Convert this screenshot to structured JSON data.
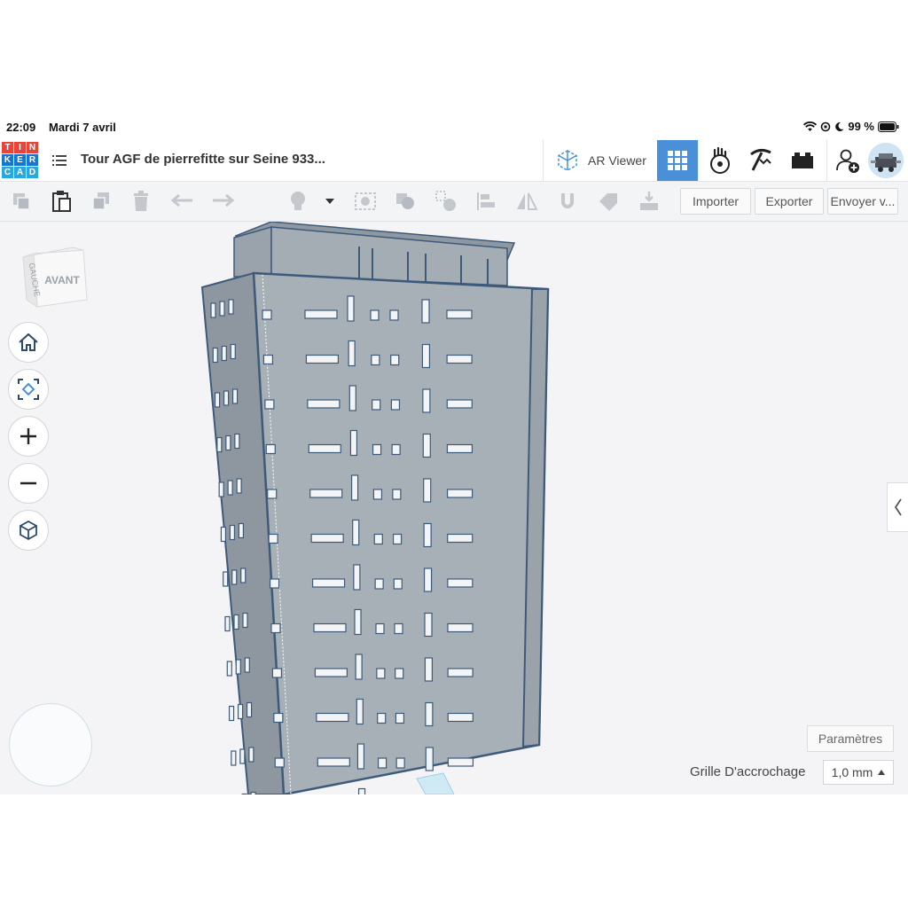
{
  "status": {
    "time": "22:09",
    "date": "Mardi 7 avril",
    "battery": "99 %"
  },
  "header": {
    "logo_letters": [
      "T",
      "I",
      "N",
      "K",
      "E",
      "R",
      "C",
      "A",
      "D"
    ],
    "logo_colors": [
      "#e8443a",
      "#e8443a",
      "#e8443a",
      "#1477d4",
      "#1477d4",
      "#1477d4",
      "#29a8e0",
      "#29a8e0",
      "#29a8e0"
    ],
    "doc_title": "Tour AGF de pierrefitte sur Seine 933...",
    "ar_viewer_label": "AR Viewer"
  },
  "toolbar": {
    "import_label": "Importer",
    "export_label": "Exporter",
    "send_label": "Envoyer v..."
  },
  "viewcube": {
    "left_face": "GAUCHE",
    "front_face": "AVANT"
  },
  "workplane": {
    "settings_label": "Paramètres",
    "snap_label": "Grille D'accrochage",
    "snap_value": "1,0 mm"
  },
  "colors": {
    "accent": "#4a90d9",
    "model_fill": "#a6aeb6",
    "model_edge": "#3d5a7a"
  },
  "model": {
    "floors": 15
  }
}
